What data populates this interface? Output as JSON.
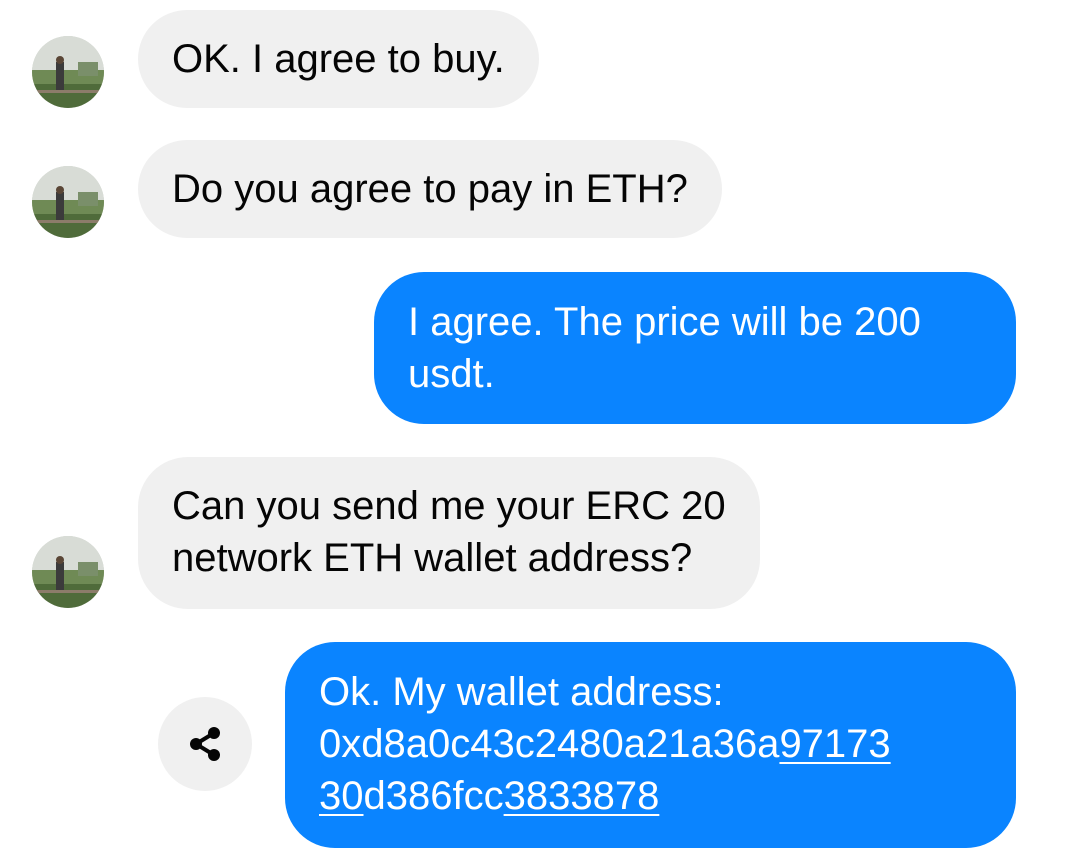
{
  "conversation": {
    "messages": [
      {
        "direction": "incoming",
        "lines": [
          "OK. I agree to buy."
        ]
      },
      {
        "direction": "incoming",
        "lines": [
          "Do you agree to pay in ETH?"
        ]
      },
      {
        "direction": "outgoing",
        "lines": [
          "I agree. The price will be 200",
          "usdt."
        ]
      },
      {
        "direction": "incoming",
        "lines": [
          "Can you send me your ERC 20",
          "network ETH wallet address?"
        ]
      },
      {
        "direction": "outgoing",
        "lines": [
          "Ok. My wallet address:"
        ],
        "address_line_1": {
          "plain": "0xd8a0c43c2480a21a36a",
          "linked": "97173"
        },
        "address_line_2": {
          "linked_start": "30",
          "plain": "d386fcc",
          "linked_end": "3833878"
        }
      }
    ],
    "share_icon": "share-icon",
    "avatar_icon": "sender-avatar"
  },
  "colors": {
    "incoming_bubble": "#f0f0f0",
    "outgoing_bubble": "#0a84ff",
    "outgoing_text": "#ffffff",
    "incoming_text": "#050505"
  }
}
